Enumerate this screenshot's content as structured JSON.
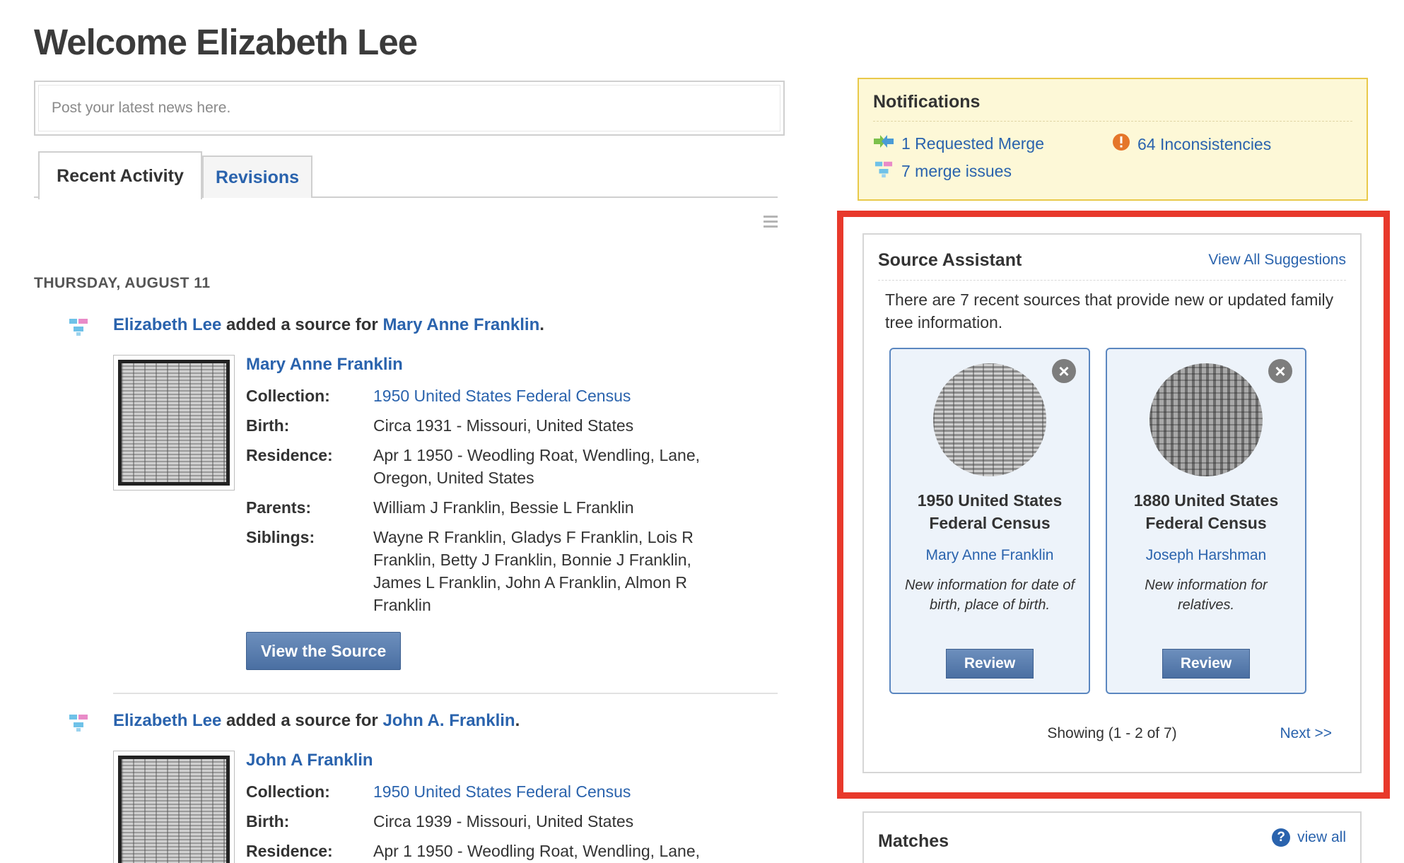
{
  "page": {
    "welcome": "Welcome Elizabeth Lee"
  },
  "news": {
    "placeholder": "Post your latest news here."
  },
  "tabs": [
    {
      "label": "Recent Activity"
    },
    {
      "label": "Revisions"
    }
  ],
  "date_heading": "THURSDAY, AUGUST 11",
  "activities": [
    {
      "actor": "Elizabeth Lee",
      "verb": " added a source for ",
      "subject": "Mary Anne Franklin",
      "end": ".",
      "record_name": "Mary Anne Franklin",
      "facts": [
        {
          "k": "Collection:",
          "v": "1950 United States Federal Census"
        },
        {
          "k": "Birth:",
          "v": "Circa 1931 - Missouri, United States"
        },
        {
          "k": "Residence:",
          "v": "Apr 1 1950 - Weodling Roat, Wendling, Lane, Oregon, United States"
        },
        {
          "k": "Parents:",
          "v": "William J Franklin, Bessie L Franklin"
        },
        {
          "k": "Siblings:",
          "v": "Wayne R Franklin, Gladys F Franklin, Lois R Franklin, Betty J Franklin, Bonnie J Franklin, James L Franklin, John A Franklin, Almon R Franklin"
        }
      ],
      "button": "View the Source"
    },
    {
      "actor": "Elizabeth Lee",
      "verb": " added a source for ",
      "subject": "John A. Franklin",
      "end": ".",
      "record_name": "John A Franklin",
      "facts": [
        {
          "k": "Collection:",
          "v": "1950 United States Federal Census"
        },
        {
          "k": "Birth:",
          "v": "Circa 1939 - Missouri, United States"
        },
        {
          "k": "Residence:",
          "v": "Apr 1 1950 - Weodling Roat, Wendling, Lane,"
        }
      ]
    }
  ],
  "notifications": {
    "title": "Notifications",
    "requested_merge": "1 Requested Merge",
    "inconsistencies": "64 Inconsistencies",
    "merge_issues": "7 merge issues"
  },
  "source_assistant": {
    "title": "Source Assistant",
    "view_all": "View All Suggestions",
    "description": "There are 7 recent sources that provide new or updated family tree information.",
    "cards": [
      {
        "title": "1950 United States Federal Census",
        "person": "Mary Anne Franklin",
        "note": "New information for date of birth, place of birth.",
        "button": "Review"
      },
      {
        "title": "1880 United States Federal Census",
        "person": "Joseph Harshman",
        "note": "New information for relatives.",
        "button": "Review"
      }
    ],
    "showing": "Showing (1 - 2 of 7)",
    "next": "Next >>"
  },
  "matches": {
    "title": "Matches",
    "view_all": "view all"
  },
  "colors": {
    "link": "#2a63ad",
    "highlight": "#e8392b",
    "notif_bg": "#fdf8d7"
  },
  "icons": {
    "tree": "tree-icon",
    "merge": "merge-arrows-icon",
    "warning": "warning-icon",
    "close": "close-icon",
    "help": "help-icon",
    "menu": "hamburger-menu-icon"
  }
}
